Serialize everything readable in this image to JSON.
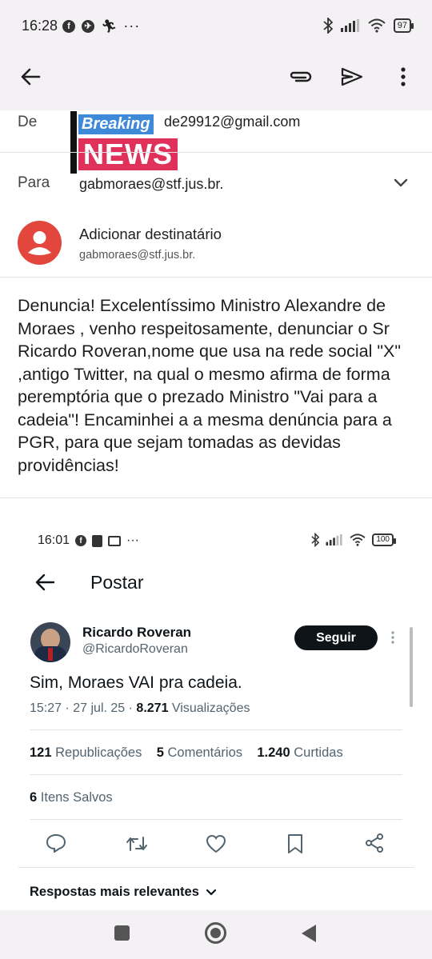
{
  "status_bar": {
    "time": "16:28",
    "dots": "···",
    "battery": "97"
  },
  "header": {
    "back_icon": "arrow-left-icon",
    "attach_icon": "paperclip-icon",
    "send_icon": "send-icon",
    "more_icon": "more-vert-icon"
  },
  "compose": {
    "from_label": "De",
    "from_value": "de29912@gmail.com",
    "overlay_breaking": "Breaking",
    "overlay_news": "NEWS",
    "to_label": "Para",
    "to_value": "gabmoraes@stf.jus.br.",
    "suggestion_title": "Adicionar destinatário",
    "suggestion_sub": "gabmoraes@stf.jus.br.",
    "body": "Denuncia! Excelentíssimo Ministro Alexandre de Moraes , venho respeitosamente, denunciar o Sr Ricardo Roveran,nome que usa na rede social \"X\" ,antigo Twitter, na qual o mesmo afirma de forma peremptória que o prezado Ministro \"Vai para a cadeia\"! Encaminhei a a mesma denúncia para a PGR, para que sejam tomadas as devidas providências!"
  },
  "attachment": {
    "status_time": "16:01",
    "status_dots": "···",
    "battery": "100",
    "page_title": "Postar",
    "author_name": "Ricardo Roveran",
    "author_handle": "@RicardoRoveran",
    "follow_label": "Seguir",
    "tweet_text": "Sim, Moraes VAI pra cadeia.",
    "tweet_meta": "15:27 · 27 jul. 25 · ",
    "views_count": "8.271",
    "views_label": "Visualizações",
    "reposts_count": "121",
    "reposts_label": "Republicações",
    "comments_count": "5",
    "comments_label": "Comentários",
    "likes_count": "1.240",
    "likes_label": "Curtidas",
    "saves_count": "6",
    "saves_label": "Itens Salvos",
    "replies_sort": "Respostas mais relevantes"
  }
}
